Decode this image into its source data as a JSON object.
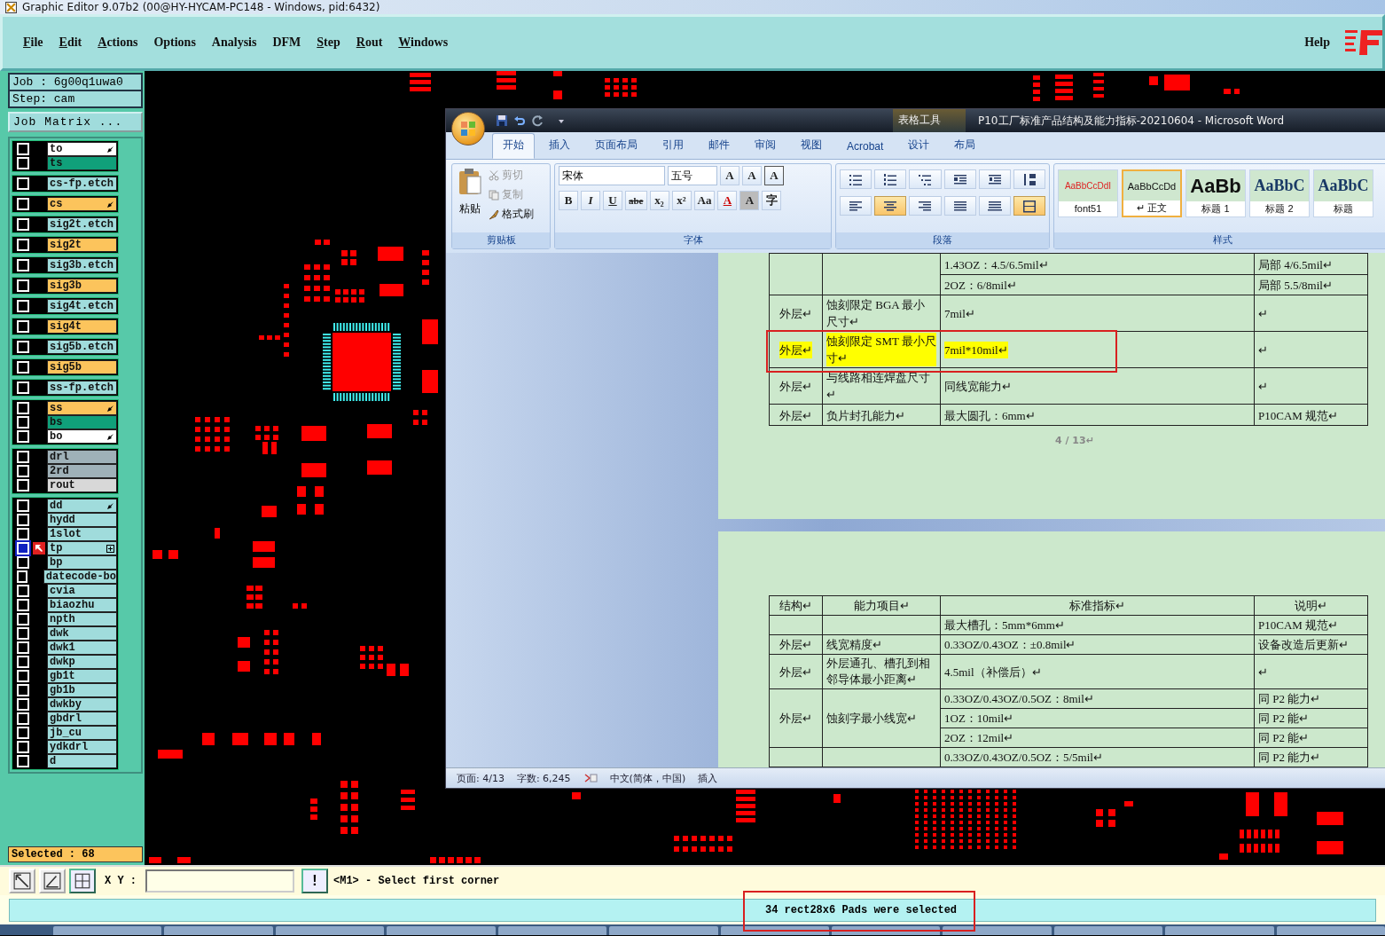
{
  "app_title": "Graphic Editor 9.07b2 (00@HY-HYCAM-PC148 - Windows, pid:6432)",
  "menu": [
    {
      "label": "File",
      "mnemonic": true
    },
    {
      "label": "Edit",
      "mnemonic": true
    },
    {
      "label": "Actions",
      "mnemonic": true
    },
    {
      "label": "Options",
      "mnemonic": false
    },
    {
      "label": "Analysis",
      "mnemonic": false
    },
    {
      "label": "DFM",
      "mnemonic": false
    },
    {
      "label": "Step",
      "mnemonic": true
    },
    {
      "label": "Rout",
      "mnemonic": true
    },
    {
      "label": "Windows",
      "mnemonic": true
    }
  ],
  "help": "Help",
  "job": "Job : 6g00q1uwa0",
  "step": "Step: cam",
  "job_matrix": "Job Matrix ...",
  "layer_groups": [
    {
      "layers": [
        {
          "name": "to",
          "color": "#ffffff",
          "flagged": true,
          "selected": false
        },
        {
          "name": "ts",
          "color": "#10a07a",
          "flagged": false,
          "selected": false
        }
      ]
    },
    {
      "layers": [
        {
          "name": "cs-fp.etch",
          "color": "#a0dcdc",
          "flagged": false,
          "selected": false
        }
      ]
    },
    {
      "layers": [
        {
          "name": "cs",
          "color": "#fcc45c",
          "flagged": true,
          "selected": false
        }
      ]
    },
    {
      "layers": [
        {
          "name": "sig2t.etch",
          "color": "#a0dcdc",
          "flagged": false,
          "selected": false
        }
      ]
    },
    {
      "layers": [
        {
          "name": "sig2t",
          "color": "#fcc45c",
          "flagged": false,
          "selected": false
        }
      ]
    },
    {
      "layers": [
        {
          "name": "sig3b.etch",
          "color": "#a0dcdc",
          "flagged": false,
          "selected": false
        }
      ]
    },
    {
      "layers": [
        {
          "name": "sig3b",
          "color": "#fcc45c",
          "flagged": false,
          "selected": false
        }
      ]
    },
    {
      "layers": [
        {
          "name": "sig4t.etch",
          "color": "#a0dcdc",
          "flagged": false,
          "selected": false
        }
      ]
    },
    {
      "layers": [
        {
          "name": "sig4t",
          "color": "#fcc45c",
          "flagged": false,
          "selected": false
        }
      ]
    },
    {
      "layers": [
        {
          "name": "sig5b.etch",
          "color": "#a0dcdc",
          "flagged": false,
          "selected": false
        }
      ]
    },
    {
      "layers": [
        {
          "name": "sig5b",
          "color": "#fcc45c",
          "flagged": false,
          "selected": false
        }
      ]
    },
    {
      "layers": [
        {
          "name": "ss-fp.etch",
          "color": "#a0dcdc",
          "flagged": false,
          "selected": false
        }
      ]
    },
    {
      "layers": [
        {
          "name": "ss",
          "color": "#fcc45c",
          "flagged": true,
          "selected": false
        },
        {
          "name": "bs",
          "color": "#10a07a",
          "flagged": false,
          "selected": false
        },
        {
          "name": "bo",
          "color": "#ffffff",
          "flagged": true,
          "selected": false
        }
      ]
    },
    {
      "layers": [
        {
          "name": "drl",
          "color": "#9fb1b8",
          "flagged": false,
          "selected": false
        },
        {
          "name": "2rd",
          "color": "#9fb1b8",
          "flagged": false,
          "selected": false
        },
        {
          "name": "rout",
          "color": "#d8d8d8",
          "flagged": false,
          "selected": false
        }
      ]
    },
    {
      "layers": [
        {
          "name": "dd",
          "color": "#a0dcdc",
          "flagged": true,
          "selected": false
        },
        {
          "name": "hydd",
          "color": "#a0dcdc",
          "flagged": false,
          "selected": false
        },
        {
          "name": "1slot",
          "color": "#a0dcdc",
          "flagged": false,
          "selected": false
        },
        {
          "name": "tp",
          "color": "#a0dcdc",
          "flagged": false,
          "selected": true
        },
        {
          "name": "bp",
          "color": "#a0dcdc",
          "flagged": false,
          "selected": false
        },
        {
          "name": "datecode-bo",
          "color": "#a0dcdc",
          "flagged": false,
          "selected": false
        },
        {
          "name": "cvia",
          "color": "#a0dcdc",
          "flagged": false,
          "selected": false
        },
        {
          "name": "biaozhu",
          "color": "#a0dcdc",
          "flagged": false,
          "selected": false
        },
        {
          "name": "npth",
          "color": "#a0dcdc",
          "flagged": false,
          "selected": false
        },
        {
          "name": "dwk",
          "color": "#a0dcdc",
          "flagged": false,
          "selected": false
        },
        {
          "name": "dwk1",
          "color": "#a0dcdc",
          "flagged": false,
          "selected": false
        },
        {
          "name": "dwkp",
          "color": "#a0dcdc",
          "flagged": false,
          "selected": false
        },
        {
          "name": "gb1t",
          "color": "#a0dcdc",
          "flagged": false,
          "selected": false
        },
        {
          "name": "gb1b",
          "color": "#a0dcdc",
          "flagged": false,
          "selected": false
        },
        {
          "name": "dwkby",
          "color": "#a0dcdc",
          "flagged": false,
          "selected": false
        },
        {
          "name": "gbdrl",
          "color": "#a0dcdc",
          "flagged": false,
          "selected": false
        },
        {
          "name": "jb_cu",
          "color": "#a0dcdc",
          "flagged": false,
          "selected": false
        },
        {
          "name": "ydkdrl",
          "color": "#a0dcdc",
          "flagged": false,
          "selected": false
        },
        {
          "name": "d",
          "color": "#a0dcdc",
          "flagged": false,
          "selected": false
        }
      ]
    }
  ],
  "selected_count": "Selected : 68",
  "coord_label": "X Y :",
  "bang": "!",
  "prompt": "<M1> - Select first corner",
  "status": "34 rect28x6 Pads were selected",
  "word": {
    "contextual": "表格工具",
    "title": "P10工厂标准产品结构及能力指标-20210604 - Microsoft Word",
    "tabs": [
      {
        "label": "开始",
        "selected": true
      },
      {
        "label": "插入",
        "selected": false
      },
      {
        "label": "页面布局",
        "selected": false
      },
      {
        "label": "引用",
        "selected": false
      },
      {
        "label": "邮件",
        "selected": false
      },
      {
        "label": "审阅",
        "selected": false
      },
      {
        "label": "视图",
        "selected": false
      },
      {
        "label": "Acrobat",
        "selected": false
      },
      {
        "label": "设计",
        "selected": false
      },
      {
        "label": "布局",
        "selected": false
      }
    ],
    "clipboard": {
      "paste": "粘贴",
      "items": [
        {
          "label": "剪切",
          "disabled": true
        },
        {
          "label": "复制",
          "disabled": true
        },
        {
          "label": "格式刷",
          "disabled": false
        }
      ],
      "group": "剪贴板"
    },
    "font": {
      "name": "宋体",
      "size": "五号",
      "top_buttons": [
        "A",
        "A",
        "A"
      ],
      "buttons": [
        "B",
        "I",
        "U",
        "abe",
        "x₂",
        "x²",
        "Aa",
        "A",
        "A",
        "字"
      ],
      "group": "字体"
    },
    "paragraph": {
      "buttons": [
        {
          "kind": "bullets",
          "selected": false
        },
        {
          "kind": "numbering",
          "selected": false
        },
        {
          "kind": "multilevel",
          "selected": false
        },
        {
          "kind": "outdent",
          "selected": false
        },
        {
          "kind": "indent",
          "selected": false
        },
        {
          "kind": "sort",
          "selected": false
        },
        {
          "kind": "align-left",
          "selected": false
        },
        {
          "kind": "align-center",
          "selected": true
        },
        {
          "kind": "align-right",
          "selected": false
        },
        {
          "kind": "justify",
          "selected": false
        },
        {
          "kind": "distributed",
          "selected": false
        },
        {
          "kind": "borders",
          "selected": true
        }
      ],
      "group": "段落"
    },
    "styles": {
      "items": [
        {
          "preview": "AaBbCcDdI",
          "name": "font51",
          "kind": "small-red",
          "selected": false
        },
        {
          "preview": "AaBbCcDd",
          "name": "↵ 正文",
          "kind": "small",
          "selected": true
        },
        {
          "preview": "AaBb",
          "name": "标题 1",
          "kind": "big",
          "selected": false
        },
        {
          "preview": "AaBbC",
          "name": "标题 2",
          "kind": "medium",
          "selected": false
        },
        {
          "preview": "AaBbC",
          "name": "标题",
          "kind": "medium",
          "selected": false
        }
      ],
      "group": "样式"
    },
    "page1_table": [
      {
        "specs": [
          {
            "spec": "1.43OZ：4.5/6.5mil↵",
            "note": "局部 4/6.5mil↵"
          },
          {
            "spec": "2OZ：6/8mil↵",
            "note": "局部 5.5/8mil↵"
          }
        ],
        "highlighted": false
      },
      {
        "structure": "外层↵",
        "item": "蚀刻限定 BGA 最小尺寸↵",
        "specs": [
          {
            "spec": "7mil↵",
            "note": "↵"
          }
        ],
        "highlighted": false
      },
      {
        "structure": "外层↵",
        "item": "蚀刻限定 SMT 最小尺寸↵",
        "specs": [
          {
            "spec": "7mil*10mil↵",
            "note": "↵"
          }
        ],
        "highlighted": true
      },
      {
        "structure": "外层↵",
        "item": "与线路相连焊盘尺寸↵",
        "specs": [
          {
            "spec": "同线宽能力↵",
            "note": "↵"
          }
        ],
        "highlighted": false
      },
      {
        "structure": "外层↵",
        "item": "负片封孔能力↵",
        "specs": [
          {
            "spec": "最大圆孔：6mm↵",
            "note": "P10CAM 规范↵"
          }
        ],
        "highlighted": false
      }
    ],
    "page_number": "4 / 13↵",
    "page2_header": [
      "结构↵",
      "能力项目↵",
      "标准指标↵",
      "说明↵"
    ],
    "page2_table": [
      {
        "specs": [
          {
            "spec": "最大槽孔：5mm*6mm↵",
            "note": "P10CAM 规范↵"
          }
        ],
        "highlighted": false
      },
      {
        "structure": "外层↵",
        "item": "线宽精度↵",
        "specs": [
          {
            "spec": "0.33OZ/0.43OZ：±0.8mil↵",
            "note": "设备改造后更新↵"
          }
        ],
        "highlighted": false
      },
      {
        "structure": "外层↵",
        "item": "外层通孔、槽孔到相邻导体最小距离↵",
        "specs": [
          {
            "spec": "4.5mil（补偿后）↵",
            "note": "↵"
          }
        ],
        "highlighted": false
      },
      {
        "structure": "外层↵",
        "item": "蚀刻字最小线宽↵",
        "specs": [
          {
            "spec": "0.33OZ/0.43OZ/0.5OZ：8mil↵",
            "note": "同 P2 能力↵"
          },
          {
            "spec": "1OZ：10mil↵",
            "note": "同 P2 能↵"
          },
          {
            "spec": "2OZ：12mil↵",
            "note": "同 P2 能↵"
          }
        ],
        "highlighted": false
      },
      {
        "specs": [
          {
            "spec": "0.33OZ/0.43OZ/0.5OZ：5/5mil↵",
            "note": "同 P2 能力↵"
          }
        ],
        "highlighted": false
      }
    ],
    "status": [
      "页面: 4/13",
      "字数: 6,245",
      "中文(简体，中国)",
      "插入"
    ]
  }
}
